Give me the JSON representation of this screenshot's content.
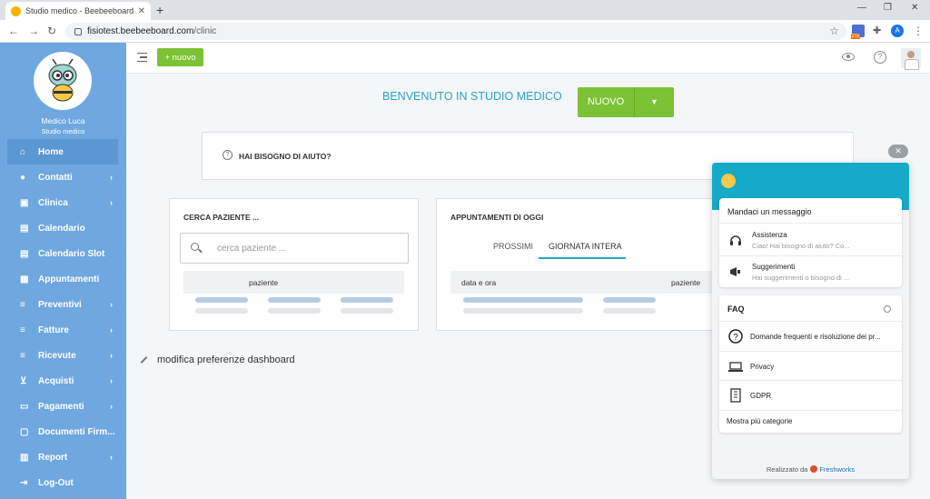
{
  "browser": {
    "tab_title": "Studio medico - Beebeeboard",
    "url_host": "fisiotest.beebeeboard.com",
    "url_path": "/clinic",
    "profile_letter": "A",
    "extension_badge": "21h"
  },
  "sidebar": {
    "user_name": "Medico Luca",
    "user_role": "Studio medico",
    "items": [
      {
        "label": "Home",
        "icon": "home-icon",
        "submenu": false
      },
      {
        "label": "Contatti",
        "icon": "person-icon",
        "submenu": true
      },
      {
        "label": "Clinica",
        "icon": "medkit-icon",
        "submenu": true
      },
      {
        "label": "Calendario",
        "icon": "calendar-icon",
        "submenu": false
      },
      {
        "label": "Calendario Slot",
        "icon": "calendar-icon",
        "submenu": false
      },
      {
        "label": "Appuntamenti",
        "icon": "calendar-check-icon",
        "submenu": false
      },
      {
        "label": "Preventivi",
        "icon": "list-icon",
        "submenu": true
      },
      {
        "label": "Fatture",
        "icon": "list-icon",
        "submenu": true
      },
      {
        "label": "Ricevute",
        "icon": "list-icon",
        "submenu": true
      },
      {
        "label": "Acquisti",
        "icon": "cart-icon",
        "submenu": true
      },
      {
        "label": "Pagamenti",
        "icon": "card-icon",
        "submenu": true
      },
      {
        "label": "Documenti Firm...",
        "icon": "document-icon",
        "submenu": false
      },
      {
        "label": "Report",
        "icon": "report-icon",
        "submenu": true
      },
      {
        "label": "Log-Out",
        "icon": "logout-icon",
        "submenu": false
      }
    ]
  },
  "topbar": {
    "new_button": "+ nuovo"
  },
  "main": {
    "welcome": "BENVENUTO IN STUDIO MEDICO",
    "new_button": "NUOVO",
    "help_text": "HAI BISOGNO DI AIUTO?",
    "search_card": {
      "title": "CERCA PAZIENTE ...",
      "placeholder": "cerca paziente ...",
      "column": "paziente"
    },
    "appointments_card": {
      "title": "APPUNTAMENTI DI OGGI",
      "tabs": [
        "PROSSIMI",
        "GIORNATA INTERA"
      ],
      "active_tab": "GIORNATA INTERA",
      "columns": [
        "data e ora",
        "paziente"
      ]
    },
    "edit_prefs": "modifica preferenze dashboard"
  },
  "widget": {
    "message_title": "Mandaci un messaggio",
    "channels": [
      {
        "title": "Assistenza",
        "subtitle": "Ciao! Hai bisogno di aiuto? Co...",
        "icon": "headset-icon"
      },
      {
        "title": "Suggerimenti",
        "subtitle": "Hai suggerimenti o bisogno di ...",
        "icon": "megaphone-icon"
      }
    ],
    "faq_title": "FAQ",
    "faq_items": [
      {
        "label": "Domande frequenti e risoluzione dei pr...",
        "icon": "question-icon"
      },
      {
        "label": "Privacy",
        "icon": "laptop-icon"
      },
      {
        "label": "GDPR",
        "icon": "building-icon"
      }
    ],
    "more": "Mostra più categorie",
    "powered_by": "Realizzato da",
    "brand": "Freshworks"
  },
  "colors": {
    "sidebar": "#6fa8e0",
    "accent_green": "#7cc235",
    "accent_teal": "#28a3c9",
    "widget_header": "#15aac8"
  }
}
